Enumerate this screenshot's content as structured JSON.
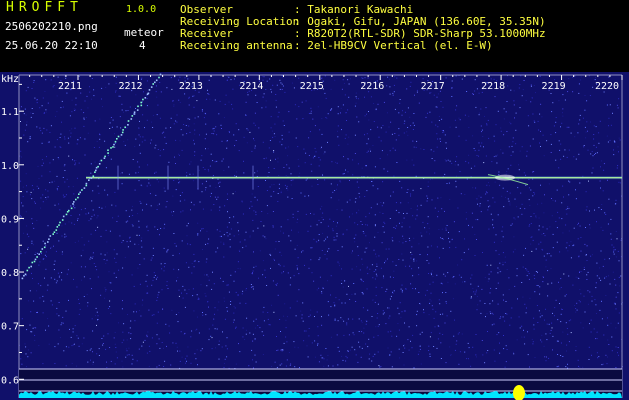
{
  "app": {
    "name": "HROFFT",
    "version": "1.0.0"
  },
  "file": {
    "name": "2506202210.png",
    "datetime": "25.06.20 22:10"
  },
  "meteor": {
    "label": "meteor",
    "count": "4"
  },
  "info": [
    {
      "label": "Observer",
      "value": "Takanori Kawachi"
    },
    {
      "label": "Receiving Location",
      "value": "Ogaki, Gifu, JAPAN (136.60E, 35.35N)"
    },
    {
      "label": "Receiver",
      "value": "R820T2(RTL-SDR) SDR-Sharp 53.1000MHz"
    },
    {
      "label": "Receiving antenna",
      "value": "2el-HB9CV Vertical (el. E-W)"
    }
  ],
  "colors": {
    "background": "#10106a",
    "header_accent": "#d8ff00",
    "info_text": "#ffff40",
    "signal": "#c8ff80",
    "meter": "#00e5ff",
    "burst": "#ffff00"
  },
  "chart_data": {
    "type": "heatmap",
    "ylabel": "kHz",
    "x_ticks": [
      "2211",
      "2212",
      "2213",
      "2214",
      "2215",
      "2216",
      "2217",
      "2218",
      "2219",
      "2220"
    ],
    "y_ticks": [
      "1.1",
      "1.0",
      "0.9",
      "0.8",
      "0.7",
      "0.6"
    ],
    "ylim": [
      0.58,
      1.16
    ],
    "carrier_khz": 0.976,
    "meteor_head_echo": {
      "x_start": "22:10.6",
      "khz_start": 0.79,
      "x_end": "22:11.9",
      "khz_end": 1.17
    }
  }
}
